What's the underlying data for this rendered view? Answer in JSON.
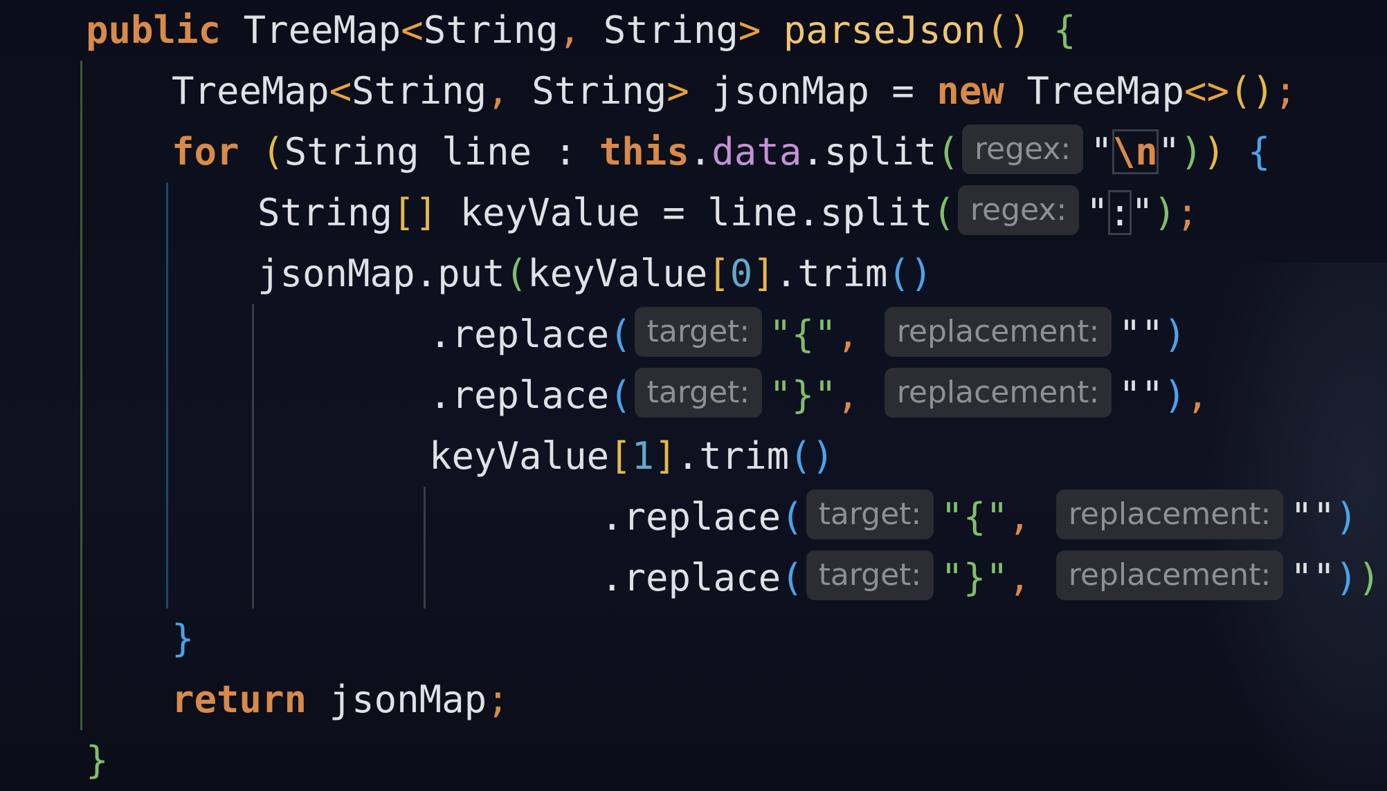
{
  "editor": {
    "line1": {
      "kw_public": "public",
      "type_treemap": "TreeMap",
      "lt": "<",
      "type_string1": "String",
      "comma": ",",
      "type_string2": " String",
      "gt": ">",
      "method_name": "parseJson",
      "parens": "()",
      "brace_open": "{"
    },
    "line2": {
      "type_treemap": "TreeMap",
      "lt": "<",
      "type_string1": "String",
      "comma": ",",
      "type_string2": " String",
      "gt": ">",
      "var_name": " jsonMap = ",
      "kw_new": "new",
      "ctor": " TreeMap",
      "diamond": "<>",
      "call": "()",
      "semi": ";"
    },
    "line3": {
      "kw_for": "for",
      "paren_open": "(",
      "decl": "String line : ",
      "kw_this": "this",
      "dot": ".",
      "field": "data",
      "method": ".split",
      "call_open": "(",
      "hint": "regex:",
      "quote_open": "\"",
      "escape": "\\n",
      "quote_close": "\"",
      "call_close": ")",
      "paren_close": ")",
      "brace_open": "{"
    },
    "line4": {
      "type": "String",
      "brackets": "[]",
      "decl": " keyValue = line.split",
      "call_open": "(",
      "hint": "regex:",
      "quote_open": "\"",
      "colon": ":",
      "quote_close": "\"",
      "call_close": ")",
      "semi": ";"
    },
    "line5": {
      "text": "jsonMap.put",
      "call_open": "(",
      "arg": "keyValue",
      "br_open": "[",
      "index": "0",
      "br_close": "]",
      "trim": ".trim",
      "trim_call": "()"
    },
    "line6": {
      "method": ".replace",
      "call_open": "(",
      "hint_target": "target:",
      "target_val": "\"{\"",
      "comma": ",",
      "hint_replacement": "replacement:",
      "replacement_val": "\"\"",
      "call_close": ")"
    },
    "line7": {
      "method": ".replace",
      "call_open": "(",
      "hint_target": "target:",
      "target_val": "\"}\"",
      "comma": ",",
      "hint_replacement": "replacement:",
      "replacement_val": "\"\"",
      "call_close": ")",
      "trailing_comma": ","
    },
    "line8": {
      "arg": "keyValue",
      "br_open": "[",
      "index": "1",
      "br_close": "]",
      "trim": ".trim",
      "trim_call": "()"
    },
    "line9": {
      "method": ".replace",
      "call_open": "(",
      "hint_target": "target:",
      "target_val": "\"{\"",
      "comma": ",",
      "hint_replacement": "replacement:",
      "replacement_val": "\"\"",
      "call_close": ")"
    },
    "line10": {
      "method": ".replace",
      "call_open": "(",
      "hint_target": "target:",
      "target_val": "\"}\"",
      "comma": ",",
      "hint_replacement": "replacement:",
      "replacement_val": "\"\"",
      "call_close": ")",
      "outer_close": ")",
      "semi": ";"
    },
    "line11": {
      "brace_close": "}"
    },
    "line12": {
      "kw_return": "return",
      "var": " jsonMap",
      "semi": ";"
    },
    "line13": {
      "brace_close": "}"
    }
  },
  "colors": {
    "background": "#0c0f1b",
    "keyword": "#d88a4b",
    "method": "#f0c674",
    "field": "#c591d6",
    "string_brace": "#7fbf6a",
    "number": "#64a8c8",
    "hint_bg": "#2b2d33",
    "hint_text": "#8d9099"
  }
}
